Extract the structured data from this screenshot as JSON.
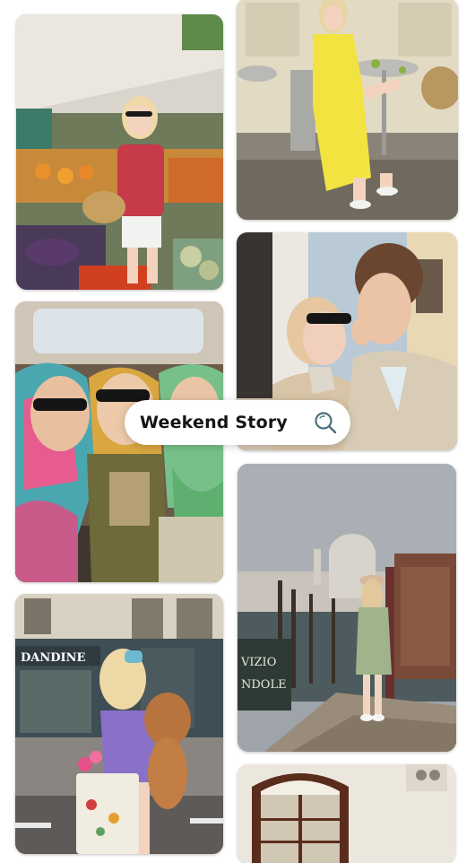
{
  "search": {
    "query": "Weekend Story",
    "icon": "search-icon"
  },
  "photos": [
    {
      "id": "photo-market",
      "storefront_sign": ""
    },
    {
      "id": "photo-cafe",
      "storefront_sign": ""
    },
    {
      "id": "photo-car-friends",
      "storefront_sign": ""
    },
    {
      "id": "photo-couple",
      "storefront_sign": ""
    },
    {
      "id": "photo-dog-street",
      "storefront_sign": "DANDINE"
    },
    {
      "id": "photo-venice",
      "storefront_sign": "VIZIO NDOLE"
    },
    {
      "id": "photo-window",
      "storefront_sign": ""
    }
  ],
  "colors": {
    "background": "#ffffff",
    "search_text": "#151515",
    "search_icon": "#4a6f7a"
  }
}
